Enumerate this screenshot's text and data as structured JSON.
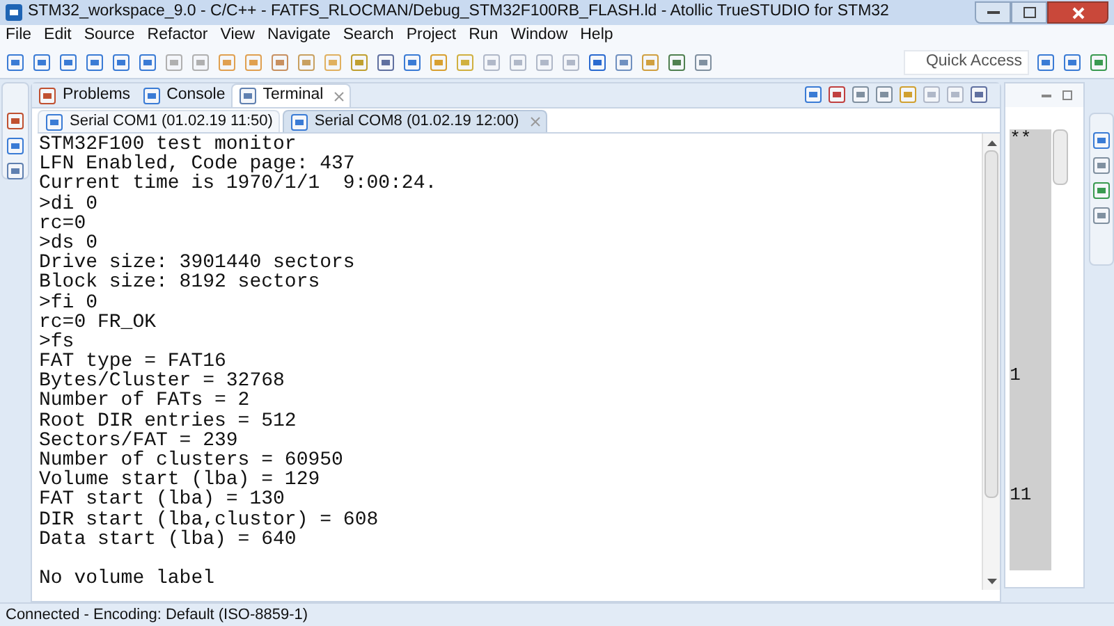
{
  "window": {
    "title": "STM32_workspace_9.0 - C/C++ - FATFS_RLOCMAN/Debug_STM32F100RB_FLASH.ld - Atollic TrueSTUDIO for STM32"
  },
  "menu": [
    "File",
    "Edit",
    "Source",
    "Refactor",
    "View",
    "Navigate",
    "Search",
    "Project",
    "Run",
    "Window",
    "Help"
  ],
  "quick_access": {
    "placeholder": "Quick Access"
  },
  "view_tabs": [
    {
      "label": "Problems",
      "selected": false
    },
    {
      "label": "Console",
      "selected": false
    },
    {
      "label": "Terminal",
      "selected": true
    }
  ],
  "terminal_tabs": [
    {
      "label": "Serial COM1 (01.02.19 11:50)",
      "selected": false
    },
    {
      "label": "Serial COM8 (01.02.19 12:00)",
      "selected": true
    }
  ],
  "terminal_lines": [
    "STM32F100 test monitor",
    "LFN Enabled, Code page: 437",
    "Current time is 1970/1/1  9:00:24.",
    ">di 0",
    "rc=0",
    ">ds 0",
    "Drive size: 3901440 sectors",
    "Block size: 8192 sectors",
    ">fi 0",
    "rc=0 FR_OK",
    ">fs",
    "FAT type = FAT16",
    "Bytes/Cluster = 32768",
    "Number of FATs = 2",
    "Root DIR entries = 512",
    "Sectors/FAT = 239",
    "Number of clusters = 60950",
    "Volume start (lba) = 129",
    "FAT start (lba) = 130",
    "DIR start (lba,clustor) = 608",
    "Data start (lba) = 640"
  ],
  "terminal_last_line": "No volume label",
  "side_column": [
    "**",
    "1",
    "11"
  ],
  "status_bar": "Connected - Encoding: Default (ISO-8859-1)"
}
